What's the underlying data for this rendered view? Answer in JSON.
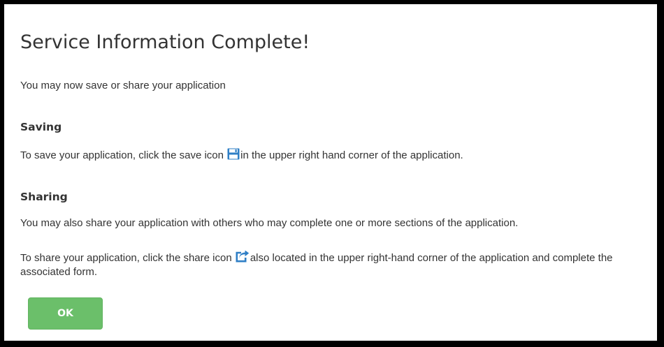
{
  "dialog": {
    "title": "Service Information Complete!",
    "intro": "You may now save or share your application",
    "saving": {
      "heading": "Saving",
      "text_before_icon": "To save your application, click the save icon ",
      "icon": "save-icon",
      "text_after_icon": "in the upper right hand corner of the application."
    },
    "sharing": {
      "heading": "Sharing",
      "paragraph1": "You may also share your application with others who may complete one or more sections of the application.",
      "text_before_icon": "To share your application, click the share icon ",
      "icon": "share-icon",
      "text_after_icon": "also located in the upper right-hand corner of the application and complete the associated form."
    },
    "ok_button_label": "OK"
  },
  "colors": {
    "frame_border": "#000000",
    "text": "#333333",
    "icon_blue": "#2f7fc6",
    "ok_button_bg": "#6bbf6a",
    "ok_button_text": "#ffffff"
  }
}
